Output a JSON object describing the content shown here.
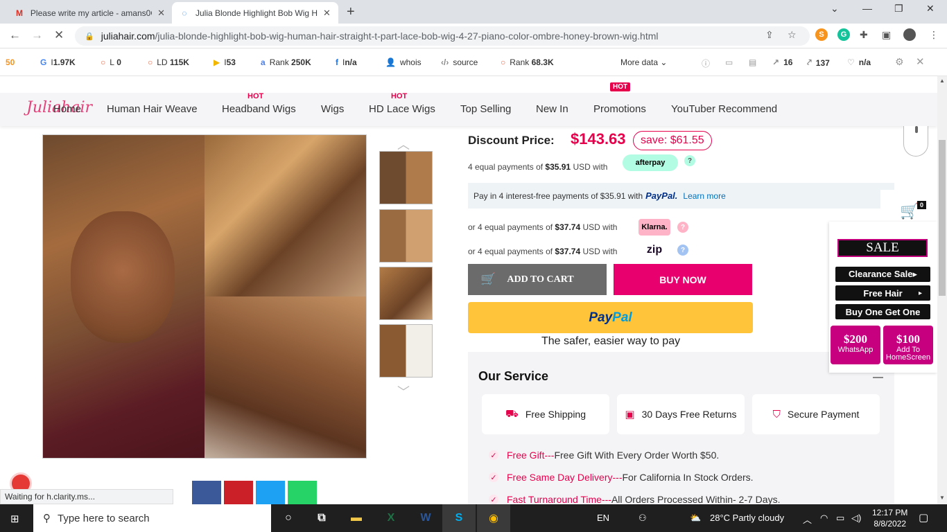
{
  "browser": {
    "tabs": [
      {
        "title": "Please write my article - amans0C",
        "favicon": "gmail-icon"
      },
      {
        "title": "Julia Blonde Highlight Bob Wig H",
        "favicon": "loading-icon"
      }
    ],
    "url_host": "juliahair.com",
    "url_path": "/julia-blonde-highlight-bob-wig-human-hair-straight-t-part-lace-bob-wig-4-27-piano-color-ombre-honey-brown-wig.html"
  },
  "seo": {
    "items": [
      {
        "label": "I",
        "value": "1.97K"
      },
      {
        "label": "L",
        "value": "0"
      },
      {
        "label": "LD",
        "value": "115K"
      },
      {
        "label": "I",
        "value": "53"
      },
      {
        "label": "Rank",
        "value": "250K"
      },
      {
        "label": "I",
        "value": "n/a"
      },
      {
        "label": "whois",
        "value": ""
      },
      {
        "label": "source",
        "value": ""
      },
      {
        "label": "Rank",
        "value": "68.3K"
      }
    ],
    "more": "More data",
    "right": [
      "16",
      "137",
      "n/a"
    ]
  },
  "site": {
    "logo": "Juliahair",
    "nav": [
      "Home",
      "Human Hair Weave",
      "Headband Wigs",
      "Wigs",
      "HD Lace Wigs",
      "Top Selling",
      "New In",
      "Promotions",
      "YouTuber Recommend"
    ],
    "hot": "HOT",
    "hotbox": "HOT"
  },
  "product": {
    "price_label": "Discount Price:",
    "price": "$143.63",
    "save": "save: $61.55",
    "afterpay": {
      "pre": "4 equal payments of ",
      "amount": "$35.91",
      "post": " USD with",
      "brand": "afterpay"
    },
    "paypal_msg": {
      "pre": "Pay in 4 interest-free payments of $35.91 with",
      "brand": "PayPal.",
      "learn": "Learn more"
    },
    "klarna": {
      "pre": "or 4 equal payments of ",
      "amount": "$37.74",
      "post": " USD with",
      "brand": "Klarna."
    },
    "zip": {
      "pre": "or 4 equal payments of ",
      "amount": "$37.74",
      "post": " USD with",
      "brand": "zip"
    },
    "add_to_cart": "ADD TO CART",
    "buy_now": "BUY NOW",
    "paypal_btn_a": "Pay",
    "paypal_btn_b": "Pal",
    "safer": "The safer, easier way to pay"
  },
  "service": {
    "title": "Our Service",
    "cards": [
      "Free Shipping",
      "30 Days Free Returns",
      "Secure Payment"
    ],
    "bullets": [
      {
        "hl": "Free Gift---",
        "text": "Free Gift With Every Order Worth $50."
      },
      {
        "hl": "Free Same Day Delivery---",
        "text": "For California In Stock Orders."
      },
      {
        "hl": "Fast Turnaround Time---",
        "text": "All Orders Processed Within- 2-7 Days."
      }
    ]
  },
  "widgets": {
    "cart_count": "0",
    "sale": "SALE",
    "buttons": [
      "Clearance Sale▸",
      "Free Hair",
      "Buy One Get One"
    ],
    "free_hair_arrow": "▸",
    "promo1": {
      "amt": "$200",
      "lbl": "WhatsApp"
    },
    "promo2": {
      "amt": "$100",
      "lbl": "Add To HomeScreen"
    }
  },
  "status": "Waiting for h.clarity.ms...",
  "taskbar": {
    "search": "Type here to search",
    "lang": "EN",
    "weather": "28°C  Partly cloudy",
    "time": "12:17 PM",
    "date": "8/8/2022"
  }
}
